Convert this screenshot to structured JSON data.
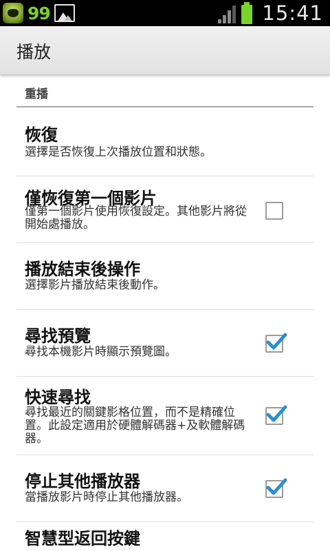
{
  "status_bar": {
    "notification_count": "99",
    "time": "15:41",
    "icons": [
      "app-badge-icon",
      "gallery-icon",
      "signal-icon",
      "battery-icon"
    ]
  },
  "header": {
    "title": "播放"
  },
  "section": {
    "title": "重播"
  },
  "preferences": [
    {
      "title": "恢復",
      "summary": "選擇是否恢復上次播放位置和狀態。",
      "has_checkbox": false
    },
    {
      "title": "僅恢復第一個影片",
      "summary": "僅第一個影片使用恢復設定。其他影片將從開始處播放。",
      "has_checkbox": true,
      "checked": false
    },
    {
      "title": "播放結束後操作",
      "summary": "選擇影片播放結束後動作。",
      "has_checkbox": false
    },
    {
      "title": "尋找預覽",
      "summary": "尋找本機影片時顯示預覽圖。",
      "has_checkbox": true,
      "checked": true
    },
    {
      "title": "快速尋找",
      "summary": "尋找最近的關鍵影格位置，而不是精確位置。此設定適用於硬體解碼器+及軟體解碼器。",
      "has_checkbox": true,
      "checked": true
    },
    {
      "title": "停止其他播放器",
      "summary": "當播放影片時停止其他播放器。",
      "has_checkbox": true,
      "checked": true
    },
    {
      "title": "智慧型返回按鍵",
      "summary": "",
      "has_checkbox": true,
      "checked": true
    }
  ],
  "colors": {
    "check_accent": "#2a8fd0",
    "status_green": "#7ad22a"
  }
}
